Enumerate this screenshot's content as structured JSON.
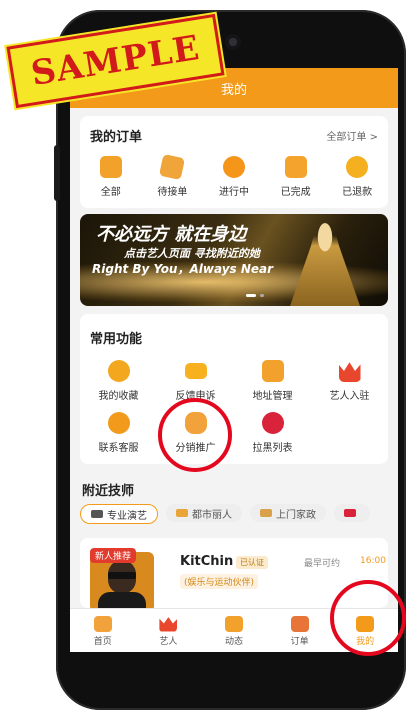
{
  "stamp_text": "SAMPLE",
  "topbar": {
    "title": "我的"
  },
  "orders": {
    "title": "我的订单",
    "all_link": "全部订单 >",
    "items": [
      {
        "label": "全部",
        "icon": "all-orders-icon",
        "color": "#f2a12a"
      },
      {
        "label": "待接单",
        "icon": "pending-icon",
        "color": "#f0a53a"
      },
      {
        "label": "进行中",
        "icon": "in-progress-icon",
        "color": "#f5961b"
      },
      {
        "label": "已完成",
        "icon": "completed-icon",
        "color": "#f4a32c"
      },
      {
        "label": "已退款",
        "icon": "refund-icon",
        "color": "#f4b01f"
      }
    ]
  },
  "banner": {
    "line1": "不必远方 就在身边",
    "line2": "点击艺人页面 寻找附近的她",
    "line3": "Right By You，Always Near"
  },
  "common": {
    "title": "常用功能",
    "row1": [
      {
        "label": "我的收藏",
        "icon": "favorites-icon",
        "color": "#f3a71e"
      },
      {
        "label": "反馈申诉",
        "icon": "feedback-mail-icon",
        "color": "#f7b01e"
      },
      {
        "label": "地址管理",
        "icon": "address-icon",
        "color": "#f2a12d"
      },
      {
        "label": "艺人入驻",
        "icon": "crown-icon",
        "color": "#e9462e"
      }
    ],
    "row2": [
      {
        "label": "联系客服",
        "icon": "customer-service-icon",
        "color": "#f19a1c"
      },
      {
        "label": "分销推广",
        "icon": "promotion-icon",
        "color": "#f2a23a"
      },
      {
        "label": "拉黑列表",
        "icon": "blacklist-icon",
        "color": "#d9233a"
      }
    ]
  },
  "nearby": {
    "title": "附近技师",
    "chips": [
      {
        "label": "专业演艺",
        "icon": "mic-icon",
        "active": true
      },
      {
        "label": "都市丽人",
        "icon": "fashion-icon",
        "active": false
      },
      {
        "label": "上门家政",
        "icon": "broom-icon",
        "active": false
      }
    ]
  },
  "technician": {
    "badge": "新人推荐",
    "name": "KitChin",
    "verified": "已认证",
    "available_label": "最早可约",
    "available_time": "16:00",
    "tag": "(娱乐与运动伙伴)"
  },
  "tabbar": [
    {
      "label": "首页",
      "icon": "home-icon",
      "active": false
    },
    {
      "label": "艺人",
      "icon": "artist-icon",
      "active": false
    },
    {
      "label": "动态",
      "icon": "feed-icon",
      "active": false
    },
    {
      "label": "订单",
      "icon": "orders-icon",
      "active": false
    },
    {
      "label": "我的",
      "icon": "profile-icon",
      "active": true
    }
  ],
  "accent_color": "#f49a1a",
  "highlight_color": "#e3081e"
}
